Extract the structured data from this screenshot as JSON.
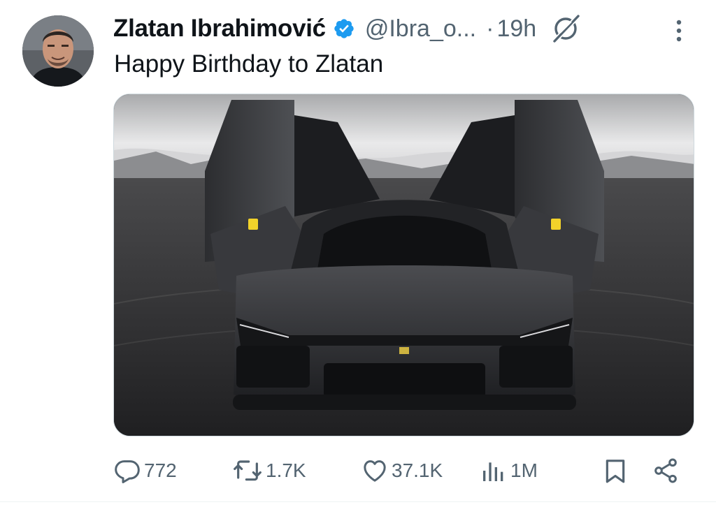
{
  "tweet": {
    "author": {
      "display_name": "Zlatan Ibrahimović",
      "handle": "@Ibra_o...",
      "verified": true,
      "avatar_icon": "profile-photo"
    },
    "separator": "·",
    "timestamp": "19h",
    "text": "Happy Birthday to Zlatan",
    "media": {
      "description_icon": "black-car-photo"
    },
    "metrics": {
      "replies": "772",
      "reposts": "1.7K",
      "likes": "37.1K",
      "views": "1M"
    },
    "icons": {
      "verified": "verified-badge-icon",
      "grok": "grok-icon",
      "more": "more-vertical-icon",
      "reply": "reply-icon",
      "repost": "repost-icon",
      "like": "heart-icon",
      "views": "views-icon",
      "bookmark": "bookmark-icon",
      "share": "share-icon"
    },
    "colors": {
      "verified": "#1d9bf0",
      "text_primary": "#0f1419",
      "text_secondary": "#536471"
    }
  }
}
